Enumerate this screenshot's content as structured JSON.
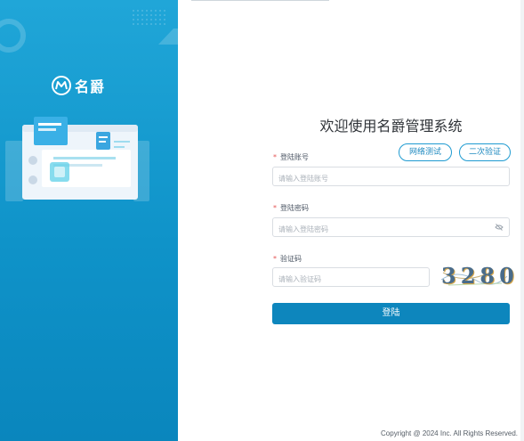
{
  "brand": {
    "name": "名爵"
  },
  "login": {
    "title": "欢迎使用名爵管理系统",
    "network_test_label": "网络测试",
    "two_factor_label": "二次验证",
    "required_mark": "*",
    "account": {
      "label": "登陆账号",
      "placeholder": "请输入登陆账号",
      "value": ""
    },
    "password": {
      "label": "登陆密码",
      "placeholder": "请输入登陆密码",
      "value": ""
    },
    "captcha": {
      "label": "验证码",
      "placeholder": "请输入验证码",
      "value": "",
      "image_text": "3280"
    },
    "submit_label": "登陆"
  },
  "footer": {
    "copyright": "Copyright @ 2024 Inc. All Rights Reserved."
  },
  "colors": {
    "panel_blue": "#1ba0d6",
    "primary": "#0d86bd",
    "required": "#e45656"
  }
}
